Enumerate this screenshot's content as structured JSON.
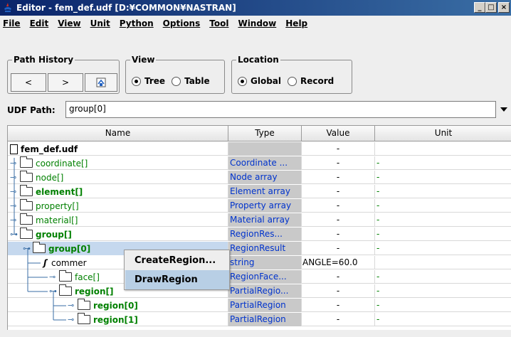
{
  "window": {
    "title": "Editor - fem_def.udf  [D:¥COMMON¥NASTRAN]",
    "minimize": "_",
    "maximize": "□",
    "close": "×"
  },
  "menu": [
    "File",
    "Edit",
    "View",
    "Unit",
    "Python",
    "Options",
    "Tool",
    "Window",
    "Help"
  ],
  "path_history": {
    "legend": "Path History",
    "back": "<",
    "forward": ">"
  },
  "view": {
    "legend": "View",
    "tree": "Tree",
    "table": "Table",
    "selected": "Tree"
  },
  "location": {
    "legend": "Location",
    "global": "Global",
    "record": "Record",
    "selected": "Global"
  },
  "udf_path": {
    "label": "UDF Path:",
    "value": "group[0]"
  },
  "table": {
    "headers": [
      "Name",
      "Type",
      "Value",
      "Unit"
    ],
    "rows": [
      {
        "name": "fem_def.udf",
        "type": "",
        "value": "-",
        "unit": ""
      },
      {
        "name": "coordinate[]",
        "type": "Coordinate ...",
        "value": "-",
        "unit": "-"
      },
      {
        "name": "node[]",
        "type": "Node array",
        "value": "-",
        "unit": "-"
      },
      {
        "name": "element[]",
        "type": "Element array",
        "value": "-",
        "unit": "-"
      },
      {
        "name": "property[]",
        "type": "Property array",
        "value": "-",
        "unit": "-"
      },
      {
        "name": "material[]",
        "type": "Material array",
        "value": "-",
        "unit": "-"
      },
      {
        "name": "group[]",
        "type": "RegionRes...",
        "value": "-",
        "unit": "-"
      },
      {
        "name": "group[0]",
        "type": "RegionResult",
        "value": "-",
        "unit": "-"
      },
      {
        "name": "commer",
        "type": "string",
        "value": "ANGLE=60.0",
        "unit": ""
      },
      {
        "name": "face[]",
        "type": "RegionFace...",
        "value": "-",
        "unit": "-"
      },
      {
        "name": "region[]",
        "type": "PartialRegio...",
        "value": "-",
        "unit": "-"
      },
      {
        "name": "region[0]",
        "type": "PartialRegion",
        "value": "-",
        "unit": "-"
      },
      {
        "name": "region[1]",
        "type": "PartialRegion",
        "value": "-",
        "unit": "-"
      }
    ]
  },
  "context_menu": [
    "CreateRegion...",
    "DrawRegion"
  ],
  "colors": {
    "type_text": "#0033cc",
    "tree_green": "#008000",
    "selection": "#c5d8ee",
    "menu_highlight": "#b8cfe5"
  }
}
